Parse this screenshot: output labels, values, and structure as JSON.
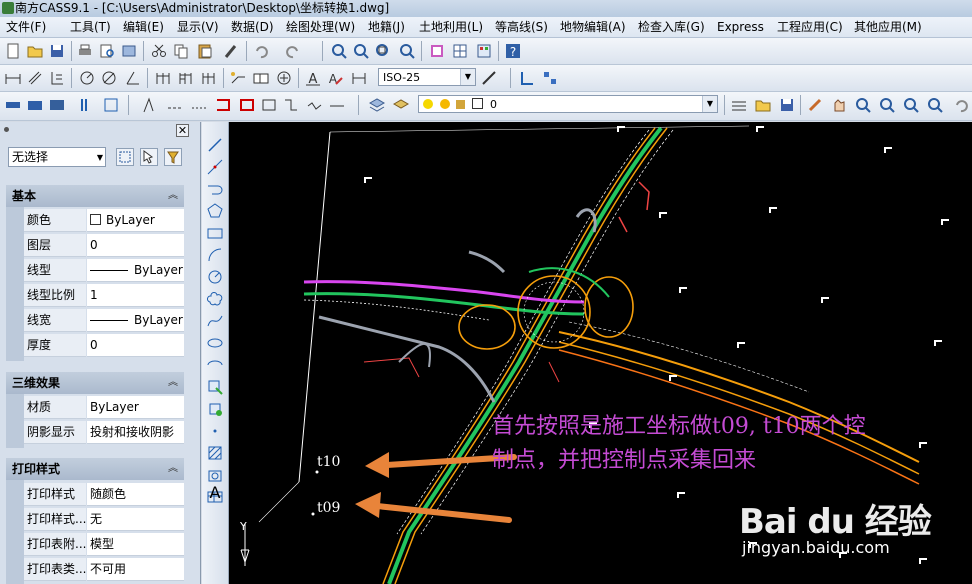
{
  "window": {
    "title": "南方CASS9.1 - [C:\\Users\\Administrator\\Desktop\\坐标转换1.dwg]"
  },
  "menu": [
    "文件(F)",
    "工具(T)",
    "编辑(E)",
    "显示(V)",
    "数据(D)",
    "绘图处理(W)",
    "地籍(J)",
    "土地利用(L)",
    "等高线(S)",
    "地物编辑(A)",
    "检查入库(G)",
    "Express",
    "工程应用(C)",
    "其他应用(M)"
  ],
  "toolbar": {
    "dimstyle_value": "ISO-25",
    "layer_value": "0"
  },
  "properties": {
    "selection": "无选择",
    "sections": [
      {
        "title": "基本",
        "rows": [
          {
            "key": "颜色",
            "value": "ByLayer"
          },
          {
            "key": "图层",
            "value": "0"
          },
          {
            "key": "线型",
            "value": "ByLayer"
          },
          {
            "key": "线型比例",
            "value": "1"
          },
          {
            "key": "线宽",
            "value": "ByLayer"
          },
          {
            "key": "厚度",
            "value": "0"
          }
        ]
      },
      {
        "title": "三维效果",
        "rows": [
          {
            "key": "材质",
            "value": "ByLayer"
          },
          {
            "key": "阴影显示",
            "value": "投射和接收阴影"
          }
        ]
      },
      {
        "title": "打印样式",
        "rows": [
          {
            "key": "打印样式",
            "value": "随颜色"
          },
          {
            "key": "打印样式...",
            "value": "无"
          },
          {
            "key": "打印表附...",
            "value": "模型"
          },
          {
            "key": "打印表类...",
            "value": "不可用"
          }
        ]
      }
    ]
  },
  "drawing": {
    "annotation_line1": "首先按照是施工坐标做t09, t10两个控",
    "annotation_line2": "制点，并把控制点采集回来",
    "point_t10": "t10",
    "point_t09": "t09",
    "ucs_y": "Y",
    "annotation_color": "#c44bd3",
    "arrow_color": "#e8843a"
  },
  "watermark": {
    "logo": "Bai du 经验",
    "url": "jingyan.baidu.com"
  },
  "colors": {
    "canvas_bg": "#000000",
    "road_green": "#22c55e",
    "road_orange": "#f59e0b",
    "road_magenta": "#d946ef"
  }
}
